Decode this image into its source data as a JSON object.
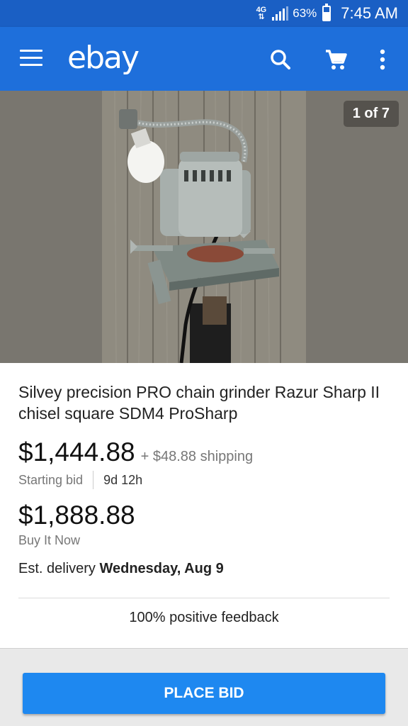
{
  "status_bar": {
    "network": "4G",
    "battery_percent": "63%",
    "battery_level": 0.63,
    "time": "7:45 AM"
  },
  "app_bar": {
    "logo": "ebay",
    "icons": [
      "hamburger-menu-icon",
      "search-icon",
      "cart-icon",
      "more-vert-icon"
    ]
  },
  "gallery": {
    "page_indicator": "1 of 7"
  },
  "listing": {
    "title": "Silvey precision PRO chain grinder Razur Sharp II chisel square SDM4 ProSharp",
    "current_price": "$1,444.88",
    "shipping": "+ $48.88 shipping",
    "bid_label": "Starting bid",
    "time_left": "9d 12h",
    "buy_it_now_price": "$1,888.88",
    "buy_it_now_label": "Buy It Now",
    "delivery_prefix": "Est. delivery ",
    "delivery_date": "Wednesday, Aug 9",
    "feedback": "100% positive feedback"
  },
  "actions": {
    "place_bid_label": "PLACE BID"
  },
  "colors": {
    "status_bar": "#1a5fc4",
    "app_bar": "#1e6fdb",
    "button": "#1e88f0"
  }
}
